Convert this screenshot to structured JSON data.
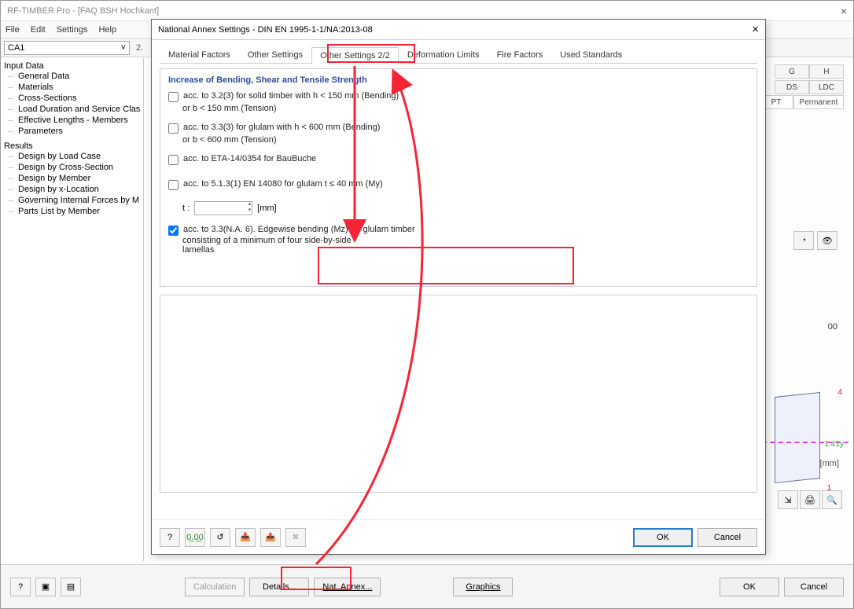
{
  "window": {
    "title": "RF-TIMBER Pro - [FAQ BSH Hochkant]",
    "close": "×"
  },
  "menu": {
    "file": "File",
    "edit": "Edit",
    "settings": "Settings",
    "help": "Help"
  },
  "combo": {
    "value": "CA1",
    "caret": "˅",
    "right_label": "2."
  },
  "tree": {
    "input": "Input Data",
    "input_items": [
      "General Data",
      "Materials",
      "Cross-Sections",
      "Load Duration and Service Class",
      "Effective Lengths - Members",
      "Parameters"
    ],
    "results": "Results",
    "results_items": [
      "Design by Load Case",
      "Design by Cross-Section",
      "Design by Member",
      "Design by x-Location",
      "Governing Internal Forces by M",
      "Parts List by Member"
    ]
  },
  "grid": {
    "col_g": "G",
    "col_h": "H",
    "row2_a": "DS",
    "row2_b": "LDC",
    "row3_a": "PT",
    "row3_b": "Permanent",
    "unit": "[mm]"
  },
  "diagram": {
    "top": "00",
    "num4": "4",
    "num1": "1",
    "ylabel": "1.41y"
  },
  "footer": {
    "calc": "Calculation",
    "details": "Details...",
    "annex": "Nat. Annex...",
    "graphics": "Graphics",
    "ok": "OK",
    "cancel": "Cancel"
  },
  "dialog": {
    "title": "National Annex Settings - DIN EN 1995-1-1/NA:2013-08",
    "close": "×",
    "tabs": [
      "Material Factors",
      "Other Settings",
      "Other Settings 2/2",
      "Deformation Limits",
      "Fire Factors",
      "Used Standards"
    ],
    "group_title": "Increase of Bending, Shear and Tensile Strength",
    "c1": "acc. to 3.2(3) for solid timber with h < 150 mm (Bending)",
    "c1b": "or b < 150 mm (Tension)",
    "c2": "acc. to 3.3(3) for glulam with h < 600 mm (Bending)",
    "c2b": "or b < 600 mm (Tension)",
    "c3": "acc. to ETA-14/0354 for BauBuche",
    "c4": "acc. to 5.1.3(1) EN 14080 for glulam t ≤ 40 mm (My)",
    "t_label": "t :",
    "t_unit": "[mm]",
    "c5a": "acc. to 3.3(N.A. 6). Edgewise bending (Mz) for glulam timber",
    "c5b": "consisting of a minimum of four side-by-side",
    "c5c": "lamellas",
    "ok": "OK",
    "cancel": "Cancel"
  }
}
